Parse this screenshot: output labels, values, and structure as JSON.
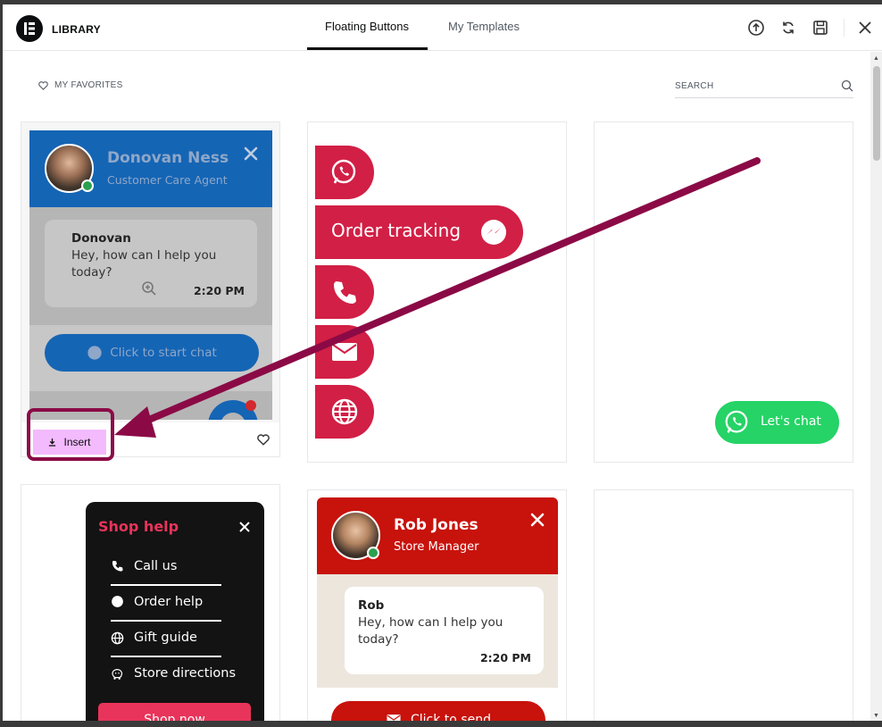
{
  "header": {
    "title": "LIBRARY",
    "tabs": [
      {
        "label": "Floating Buttons"
      },
      {
        "label": "My Templates"
      }
    ]
  },
  "toolbar": {
    "favorites_label": "MY FAVORITES",
    "search_placeholder": "SEARCH"
  },
  "cards": {
    "c1": {
      "agent_name": "Donovan Ness",
      "agent_role": "Customer Care Agent",
      "msg_name": "Donovan",
      "msg_text_1": "Hey, how can I help you",
      "msg_text_2": "today?",
      "msg_time": "2:20 PM",
      "cta": "Click to start chat",
      "insert_label": "Insert"
    },
    "c2": {
      "item_label": "Order tracking"
    },
    "c3": {
      "label": "Let's chat"
    },
    "c4": {
      "title": "Shop help",
      "items": [
        "Call us",
        "Order help",
        "Gift guide",
        "Store directions"
      ],
      "button": "Shop now"
    },
    "c5": {
      "agent_name": "Rob Jones",
      "agent_role": "Store Manager",
      "msg_name": "Rob",
      "msg_text_1": "Hey, how can I help you",
      "msg_text_2": "today?",
      "msg_time": "2:20 PM",
      "cta": "Click to send"
    }
  },
  "colors": {
    "accent": "#0c0d0e",
    "insert_bg": "#f3bafd",
    "annotation": "#8b0a46",
    "crimson": "#d21f45",
    "blue": "#1976d2",
    "whatsapp": "#25d366",
    "red": "#c8120c"
  }
}
